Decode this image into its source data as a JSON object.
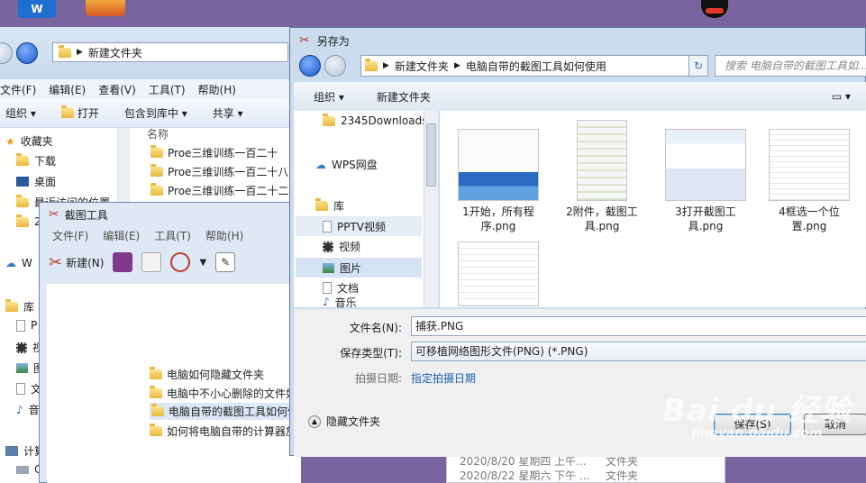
{
  "desktop": {
    "wps_label": "W"
  },
  "explorer": {
    "path": [
      "新建文件夹"
    ],
    "menus": [
      "文件(F)",
      "编辑(E)",
      "查看(V)",
      "工具(T)",
      "帮助(H)"
    ],
    "toolbar": {
      "organize": "组织",
      "open": "打开",
      "include_library": "包含到库中",
      "share": "共享"
    },
    "nav": [
      {
        "label": "收藏夹",
        "icon": "star-icon"
      },
      {
        "label": "下载",
        "icon": "folder-icon"
      },
      {
        "label": "桌面",
        "icon": "desktop-icon"
      },
      {
        "label": "最近访问的位置",
        "icon": "recent-icon"
      },
      {
        "label": "2",
        "icon": "folder-icon"
      },
      {
        "label": "W",
        "icon": "cloud-icon"
      },
      {
        "label": "库",
        "icon": "library-icon"
      },
      {
        "label": "P",
        "icon": "pptv-icon"
      },
      {
        "label": "视",
        "icon": "video-icon"
      },
      {
        "label": "图",
        "icon": "picture-icon"
      },
      {
        "label": "文",
        "icon": "document-icon"
      },
      {
        "label": "音",
        "icon": "music-icon"
      },
      {
        "label": "计算",
        "icon": "computer-icon"
      },
      {
        "label": "C",
        "icon": "disk-icon"
      }
    ],
    "column_name": "名称",
    "files": [
      "Proe三维训练一百二十",
      "Proe三维训练一百二十八",
      "Proe三维训练一百二十二"
    ],
    "files_lower": [
      "电脑如何隐藏文件夹",
      "电脑中不小心删除的文件如",
      "电脑自带的截图工具如何使",
      "如何将电脑自带的计算器放"
    ]
  },
  "snip": {
    "title": "截图工具",
    "menus": [
      "文件(F)",
      "编辑(E)",
      "工具(T)",
      "帮助(H)"
    ],
    "new_label": "新建(N)"
  },
  "saveas": {
    "title": "另存为",
    "path": [
      "新建文件夹",
      "电脑自带的截图工具如何使用"
    ],
    "search_placeholder": "搜索 电脑自带的截图工具如...",
    "toolbar": {
      "organize": "组织",
      "new_folder": "新建文件夹"
    },
    "nav": [
      {
        "label": "2345Downloads",
        "icon": "folder-icon"
      },
      {
        "label": "WPS网盘",
        "icon": "cloud-icon"
      },
      {
        "label": "库",
        "icon": "library-icon"
      },
      {
        "label": "PPTV视频",
        "icon": "pptv-icon"
      },
      {
        "label": "视频",
        "icon": "video-icon"
      },
      {
        "label": "图片",
        "icon": "picture-icon"
      },
      {
        "label": "文档",
        "icon": "document-icon"
      },
      {
        "label": "音乐",
        "icon": "music-icon"
      }
    ],
    "files": [
      {
        "name": "1开始，所有程序.png"
      },
      {
        "name": "2附件，截图工具.png"
      },
      {
        "name": "3打开截图工具.png"
      },
      {
        "name": "4框选一个位置.png"
      },
      {
        "name": ""
      }
    ],
    "filename_label": "文件名(N):",
    "filename_value": "捕获.PNG",
    "filetype_label": "保存类型(T):",
    "filetype_value": "可移植网络图形文件(PNG) (*.PNG)",
    "date_label": "拍摄日期:",
    "date_link": "指定拍摄日期",
    "hide_folders": "隐藏文件夹",
    "save_button": "保存(S)",
    "cancel_button": "取消"
  },
  "background_list": [
    {
      "date": "2020/8/20 星期四 上午...",
      "type": "文件夹"
    },
    {
      "date": "2020/8/22 星期六 下午 ...",
      "type": "文件夹"
    }
  ],
  "watermark": {
    "main": "Bai du 经验",
    "sub": "jingyan.baidu.com"
  }
}
